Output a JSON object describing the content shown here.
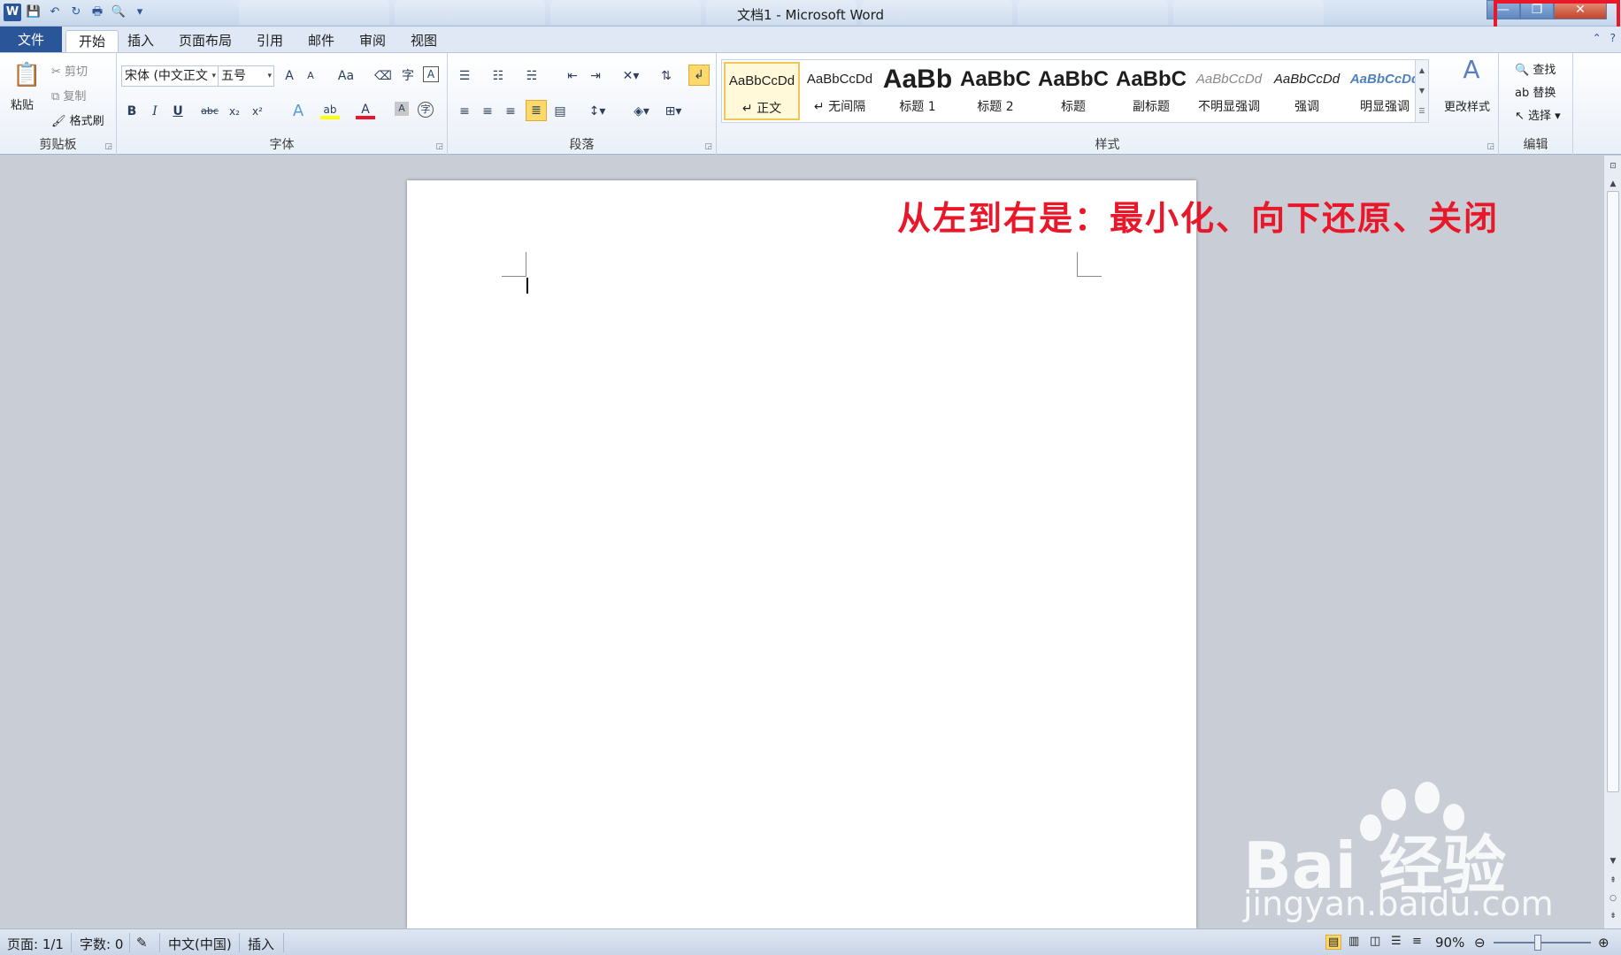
{
  "window": {
    "title": "文档1 - Microsoft Word",
    "min": "—",
    "max": "❐",
    "close": "✕"
  },
  "qat": {
    "logo": "W",
    "save": "💾",
    "undo": "↶",
    "redo": "↻",
    "print": "🖶",
    "preview": "🔍",
    "customize": "▾"
  },
  "tabs": {
    "file": "文件",
    "home": "开始",
    "insert": "插入",
    "layout": "页面布局",
    "references": "引用",
    "mailings": "邮件",
    "review": "审阅",
    "view": "视图"
  },
  "clipboard": {
    "paste": "粘贴",
    "cut": "剪切",
    "copy": "复制",
    "format_painter": "格式刷",
    "label": "剪贴板"
  },
  "font": {
    "name": "宋体 (中文正文",
    "size": "五号",
    "label": "字体",
    "bold": "B",
    "italic": "I",
    "underline": "U",
    "strike": "abc",
    "sub": "x₂",
    "sup": "x²",
    "grow": "A",
    "shrink": "A",
    "case": "Aa",
    "color_a": "A",
    "shade_a": "A",
    "phonetic": "字",
    "border_a": "A",
    "enclose": "字"
  },
  "paragraph": {
    "label": "段落"
  },
  "styles": {
    "label": "样式",
    "items": [
      {
        "sample": "AaBbCcDd",
        "name": "↵ 正文"
      },
      {
        "sample": "AaBbCcDd",
        "name": "↵ 无间隔"
      },
      {
        "sample": "AaBb",
        "name": "标题 1"
      },
      {
        "sample": "AaBbC",
        "name": "标题 2"
      },
      {
        "sample": "AaBbC",
        "name": "标题"
      },
      {
        "sample": "AaBbC",
        "name": "副标题"
      },
      {
        "sample": "AaBbCcDd",
        "name": "不明显强调"
      },
      {
        "sample": "AaBbCcDd",
        "name": "强调"
      },
      {
        "sample": "AaBbCcDd",
        "name": "明显强调"
      }
    ],
    "change": "更改样式"
  },
  "editing": {
    "label": "编辑",
    "find": "查找",
    "replace": "替换",
    "select": "选择"
  },
  "annotation": "从左到右是：最小化、向下还原、关闭",
  "watermark": {
    "brand": "Bai  经验",
    "url": "jingyan.baidu.com"
  },
  "status": {
    "page": "页面: 1/1",
    "words": "字数: 0",
    "lang": "中文(中国)",
    "mode": "插入",
    "zoom": "90%"
  }
}
